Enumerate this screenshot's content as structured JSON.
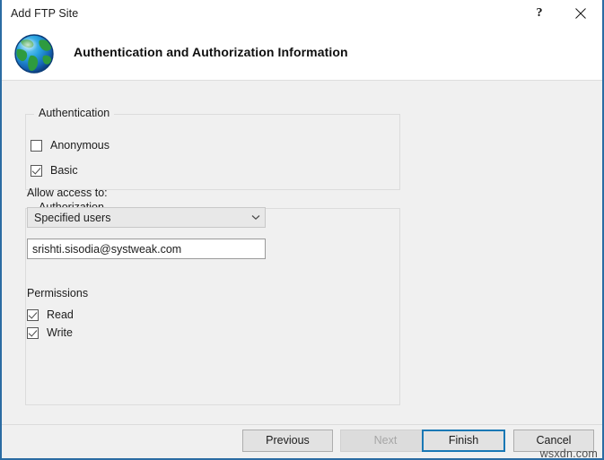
{
  "window": {
    "title": "Add FTP Site",
    "help_button": "?",
    "close_button": "✕"
  },
  "header": {
    "icon": "globe-icon",
    "title": "Authentication and Authorization Information"
  },
  "authentication": {
    "group_label": "Authentication",
    "options": [
      {
        "label": "Anonymous",
        "checked": false
      },
      {
        "label": "Basic",
        "checked": true
      }
    ]
  },
  "authorization": {
    "group_label": "Authorization",
    "allow_access_label": "Allow access to:",
    "allow_access_value": "Specified users",
    "allow_access_options": [
      "Specified users"
    ],
    "users_value": "srishti.sisodia@systweak.com",
    "users_placeholder": "",
    "permissions_label": "Permissions",
    "permissions": [
      {
        "label": "Read",
        "checked": true
      },
      {
        "label": "Write",
        "checked": true
      }
    ]
  },
  "footer": {
    "previous_label": "Previous",
    "next_label": "Next",
    "finish_label": "Finish",
    "cancel_label": "Cancel"
  },
  "watermark": "wsxdn.com",
  "colors": {
    "window_border": "#2b6ca3",
    "body_background": "#f0f0f0",
    "default_button_border": "#1978b5",
    "text": "#1c1c1c",
    "disabled_text": "#a6a6a6"
  }
}
